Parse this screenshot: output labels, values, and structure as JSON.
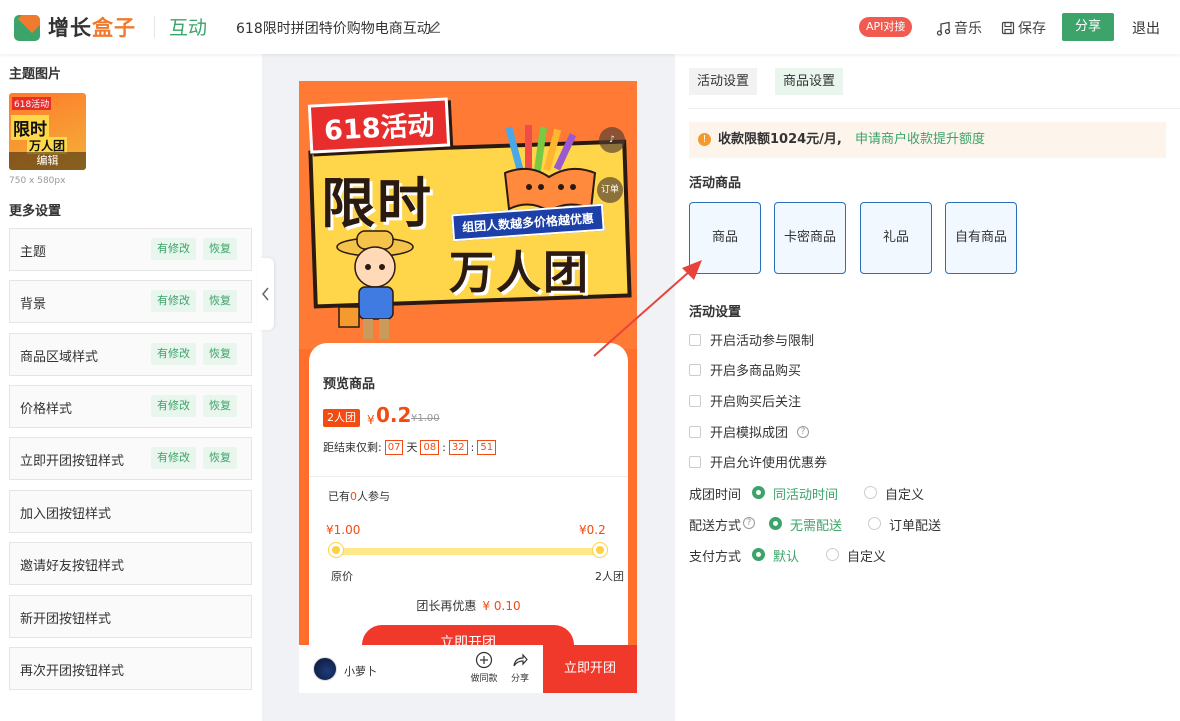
{
  "header": {
    "logo_text_a": "增长",
    "logo_text_b": "盒子",
    "section": "互动",
    "activity_title": "618限时拼团特价购物电商互动",
    "api_badge": "API对接",
    "music": "音乐",
    "save": "保存",
    "share": "分享",
    "exit": "退出"
  },
  "left": {
    "theme_image_title": "主题图片",
    "thumb_tag": "618活动",
    "thumb_big": "限时",
    "thumb_big2": "万人团",
    "thumb_edit": "编辑",
    "thumb_size": "750 x 580px",
    "more_settings_title": "更多设置",
    "modified_label": "有修改",
    "restore_label": "恢复",
    "items": [
      {
        "label": "主题"
      },
      {
        "label": "背景"
      },
      {
        "label": "商品区域样式"
      },
      {
        "label": "价格样式"
      },
      {
        "label": "立即开团按钮样式"
      },
      {
        "label": "加入团按钮样式"
      },
      {
        "label": "邀请好友按钮样式"
      },
      {
        "label": "新开团按钮样式"
      },
      {
        "label": "再次开团按钮样式"
      }
    ]
  },
  "preview": {
    "banner_tag": "618活动",
    "banner_big1": "限时",
    "banner_strip": "组团人数越多价格越优惠",
    "banner_big2": "万人团",
    "order_fab": "订单",
    "card_title": "预览商品",
    "group_tag": "2人团",
    "currency": "¥",
    "price": "0.2",
    "original_price": "¥1.00",
    "countdown_label": "距结束仅剩:",
    "cd_days": "07",
    "cd_day_unit": "天",
    "cd_hours": "08",
    "cd_minutes": "32",
    "cd_seconds": "51",
    "joined_prefix": "已有",
    "joined_count": "0",
    "joined_suffix": "人参与",
    "price_left": "¥1.00",
    "price_right": "¥0.2",
    "label_left": "原价",
    "label_right": "2人团",
    "leader_discount_label": "团长再优惠",
    "leader_discount_value": "¥ 0.10",
    "cta": "立即开团",
    "shop_name": "小萝卜",
    "make_same": "做同款",
    "share_icon_label": "分享",
    "bottom_cta": "立即开团"
  },
  "right": {
    "tab_activity": "活动设置",
    "tab_goods": "商品设置",
    "notice_text": "收款限额1024元/月,",
    "notice_link": "申请商户收款提升额度",
    "goods_title": "活动商品",
    "goods_types": [
      "商品",
      "卡密商品",
      "礼品",
      "自有商品"
    ],
    "settings_title": "活动设置",
    "checkboxes": [
      "开启活动参与限制",
      "开启多商品购买",
      "开启购买后关注",
      "开启模拟成团",
      "开启允许使用优惠券"
    ],
    "group_time_label": "成团时间",
    "group_time_opt1": "同活动时间",
    "group_time_opt2": "自定义",
    "delivery_label": "配送方式",
    "delivery_opt1": "无需配送",
    "delivery_opt2": "订单配送",
    "payment_label": "支付方式",
    "payment_opt1": "默认",
    "payment_opt2": "自定义"
  },
  "colors": {
    "brand_green": "#3ca36a",
    "brand_orange": "#f07a2e",
    "accent_red": "#f0392b",
    "selected_border": "#2b6fb8"
  }
}
